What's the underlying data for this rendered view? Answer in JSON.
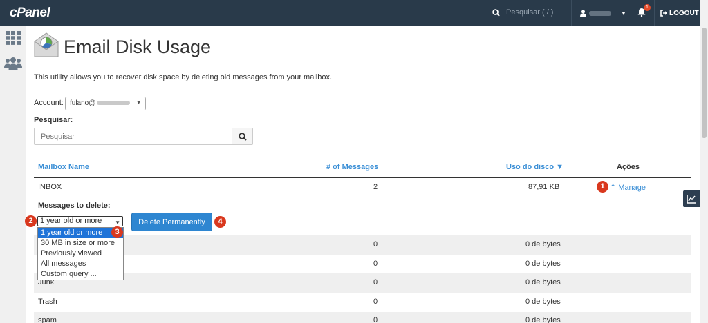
{
  "header": {
    "logo": "cPanel",
    "search_placeholder": "Pesquisar ( / )",
    "notification_count": "1",
    "logout_label": "LOGOUT"
  },
  "page": {
    "title": "Email Disk Usage",
    "description": "This utility allows you to recover disk space by deleting old messages from your mailbox."
  },
  "account": {
    "label": "Account:",
    "value_prefix": "fulano@"
  },
  "search": {
    "label": "Pesquisar:",
    "placeholder": "Pesquisar"
  },
  "table": {
    "headers": {
      "mailbox": "Mailbox Name",
      "messages": "# of Messages",
      "usage": "Uso do disco ▼",
      "actions": "Ações"
    },
    "inbox": {
      "name": "INBOX",
      "messages": "2",
      "usage": "87,91 KB",
      "action": "Manage"
    },
    "rows": [
      {
        "name": "",
        "messages": "0",
        "usage": "0 de bytes"
      },
      {
        "name": "",
        "messages": "0",
        "usage": "0 de bytes"
      },
      {
        "name": "Junk",
        "messages": "0",
        "usage": "0 de bytes"
      },
      {
        "name": "Trash",
        "messages": "0",
        "usage": "0 de bytes"
      },
      {
        "name": "spam",
        "messages": "0",
        "usage": "0 de bytes"
      }
    ]
  },
  "delete_panel": {
    "label": "Messages to delete:",
    "selected": "1 year old or more",
    "options": [
      "1 year old or more",
      "30 MB in size or more",
      "Previously viewed",
      "All messages",
      "Custom query ..."
    ],
    "button": "Delete Permanently"
  },
  "annotations": [
    "1",
    "2",
    "3",
    "4"
  ],
  "colors": {
    "topbar": "#293a4a",
    "link": "#3b8fd6",
    "primary_button": "#2e86d1",
    "badge": "#d9381e"
  }
}
